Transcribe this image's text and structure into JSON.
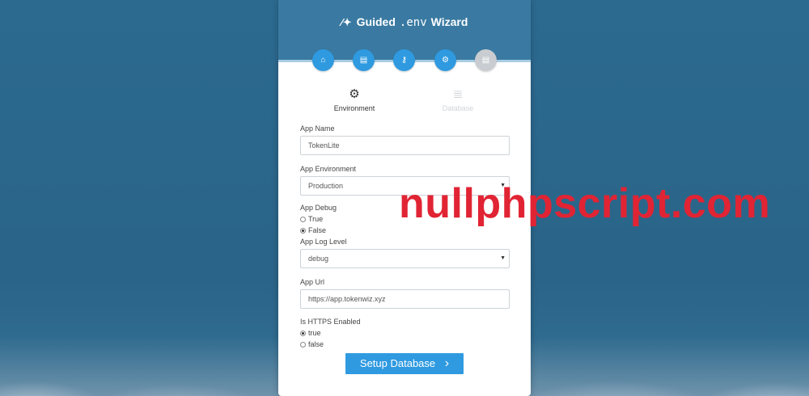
{
  "header": {
    "title_prefix": "Guided",
    "title_env": ".env",
    "title_suffix": "Wizard",
    "wand_icon": "magic-wand-icon"
  },
  "steps": [
    {
      "icon": "home-icon",
      "glyph": "⌂",
      "active": true
    },
    {
      "icon": "list-icon",
      "glyph": "▤",
      "active": true
    },
    {
      "icon": "key-icon",
      "glyph": "⚷",
      "active": true
    },
    {
      "icon": "gear-icon",
      "glyph": "⚙",
      "active": true
    },
    {
      "icon": "list-icon",
      "glyph": "▤",
      "active": false
    }
  ],
  "tabs": {
    "environment": {
      "label": "Environment",
      "icon": "gear-icon",
      "glyph": "⚙"
    },
    "database": {
      "label": "Database",
      "icon": "database-icon",
      "glyph": "≣"
    }
  },
  "form": {
    "app_name": {
      "label": "App Name",
      "value": "TokenLite"
    },
    "app_environment": {
      "label": "App Environment",
      "value": "Production"
    },
    "app_debug": {
      "label": "App Debug",
      "options": [
        "True",
        "False"
      ],
      "selected": "False"
    },
    "app_log_level": {
      "label": "App Log Level",
      "value": "debug"
    },
    "app_url": {
      "label": "App Url",
      "value": "https://app.tokenwiz.xyz"
    },
    "https_enabled": {
      "label": "Is HTTPS Enabled",
      "options": [
        "true",
        "false"
      ],
      "selected": "true"
    }
  },
  "buttons": {
    "setup_database": {
      "label": "Setup Database",
      "chevron": "›"
    }
  },
  "watermark": {
    "text": "nullphpscript.com",
    "color": "#e12434"
  },
  "colors": {
    "accent": "#2f9ae0",
    "header": "#3a7aa2",
    "background": "#2c6a90"
  }
}
